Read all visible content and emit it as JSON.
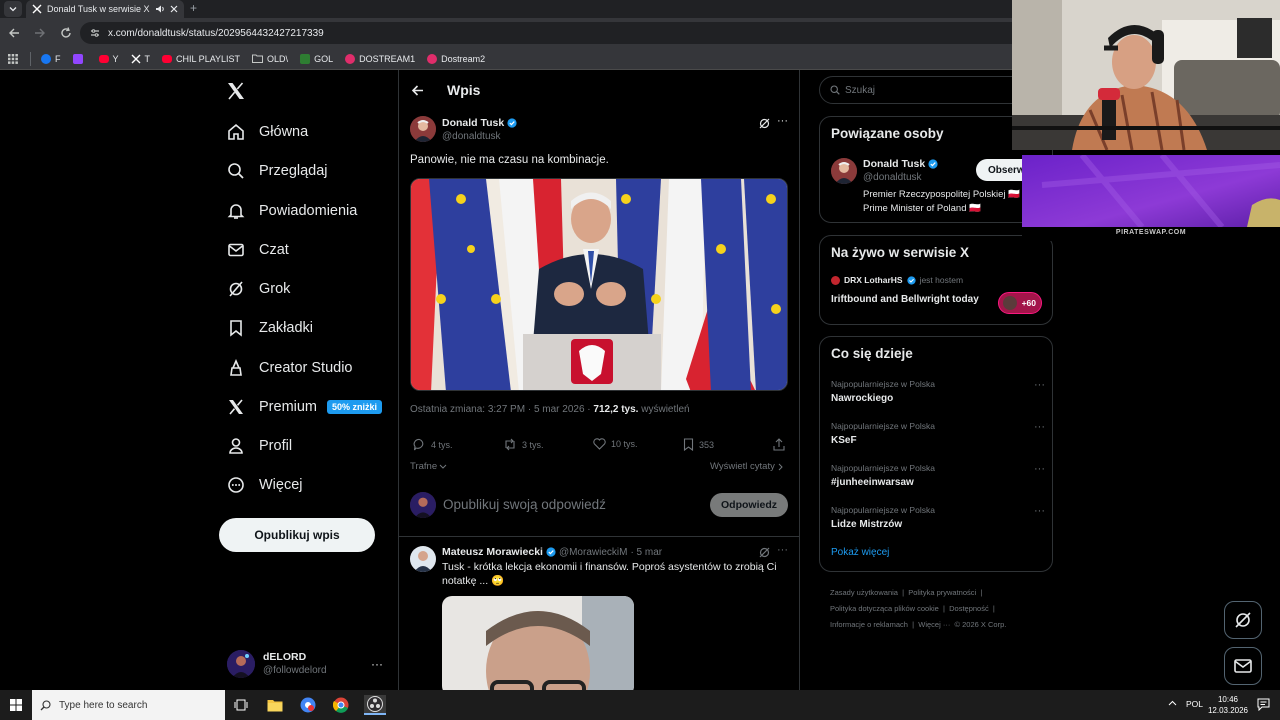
{
  "browser": {
    "tab_title": "Donald Tusk w serwisie X: „",
    "url": "x.com/donaldtusk/status/2029564432427217339",
    "bookmarks": [
      "F",
      "",
      "Y",
      "T",
      "CHIL PLAYLIST",
      "OLD\\",
      "GOL",
      "DOSTREAM1",
      "Dostream2"
    ]
  },
  "nav": {
    "items": [
      {
        "label": "Główna",
        "icon": "home-icon"
      },
      {
        "label": "Przeglądaj",
        "icon": "search-icon"
      },
      {
        "label": "Powiadomienia",
        "icon": "bell-icon"
      },
      {
        "label": "Czat",
        "icon": "mail-icon"
      },
      {
        "label": "Grok",
        "icon": "grok-icon"
      },
      {
        "label": "Zakładki",
        "icon": "bookmark-icon"
      },
      {
        "label": "Creator Studio",
        "icon": "creator-icon"
      },
      {
        "label": "Premium",
        "icon": "x-icon"
      },
      {
        "label": "Profil",
        "icon": "person-icon"
      },
      {
        "label": "Więcej",
        "icon": "more-circle-icon"
      }
    ],
    "premium_badge": "50% zniżki",
    "post_button": "Opublikuj wpis",
    "account": {
      "name": "dELORD",
      "handle": "@followdelord"
    }
  },
  "header": {
    "title": "Wpis"
  },
  "post": {
    "author_name": "Donald Tusk",
    "author_handle": "@donaldtusk",
    "text": "Panowie, nie ma czasu na kombinacje.",
    "meta_prefix": "Ostatnia zmiana: 3:27 PM · 5 mar 2026 · ",
    "views": "712,2 tys.",
    "views_label": " wyświetleń",
    "stats": {
      "replies": "4 tys.",
      "reposts": "3 tys.",
      "likes": "10 tys.",
      "bookmarks": "353"
    },
    "sort_label": "Trafne",
    "quotes_label": "Wyświetl cytaty"
  },
  "reply_box": {
    "placeholder": "Opublikuj swoją odpowiedź",
    "button": "Odpowiedz"
  },
  "reply": {
    "author_name": "Mateusz Morawiecki",
    "author_handle": "@MorawieckiM",
    "time": " · 5 mar",
    "text_line1": "Tusk - krótka lekcja ekonomii i finansów. Poproś asystentów to zrobią Ci",
    "text_line2": "notatkę ... 🙄"
  },
  "sidebar": {
    "search_placeholder": "Szukaj",
    "related": {
      "title": "Powiązane osoby",
      "name": "Donald Tusk",
      "handle": "@donaldtusk",
      "follow_button": "Obserwuj",
      "bio_line1": "Premier Rzeczypospolitej Polskiej 🇵🇱",
      "bio_line2": "Prime Minister of Poland 🇵🇱"
    },
    "live": {
      "title": "Na żywo w serwisie X",
      "host": "DRX LotharHS",
      "host_suffix": "jest hostem",
      "stream_title": "Iriftbound and Bellwright today",
      "listeners": "+60"
    },
    "trends": {
      "title": "Co się dzieje",
      "items": [
        {
          "category": "Najpopularniejsze w Polska",
          "name": "Nawrockiego"
        },
        {
          "category": "Najpopularniejsze w Polska",
          "name": "KSeF"
        },
        {
          "category": "Najpopularniejsze w Polska",
          "name": "#junheeinwarsaw"
        },
        {
          "category": "Najpopularniejsze w Polska",
          "name": "Lidze Mistrzów"
        }
      ],
      "show_more": "Pokaż więcej"
    },
    "footer": {
      "line1": [
        "Zasady użytkowania",
        "Polityka prywatności"
      ],
      "line2": [
        "Polityka dotycząca plików cookie",
        "Dostępność"
      ],
      "line3": [
        "Informacje o reklamach",
        "Więcej ···",
        "© 2026 X Corp."
      ]
    }
  },
  "banner": {
    "text": "PIRATESWAP.COM"
  },
  "taskbar": {
    "search_placeholder": "Type here to search",
    "language": "POL",
    "time": "10:46",
    "date": "12.03.2026"
  },
  "colors": {
    "accent": "#1d9bf0",
    "background": "#000000",
    "border": "#2f3336",
    "muted": "#71767b"
  }
}
